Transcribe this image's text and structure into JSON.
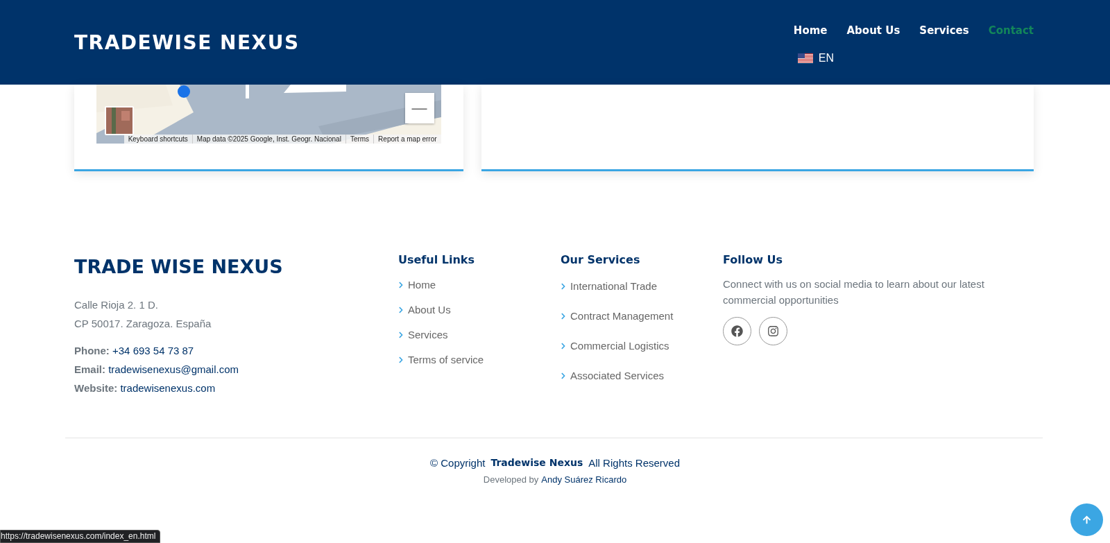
{
  "header": {
    "logo": "TRADEWISE NEXUS",
    "nav": [
      {
        "label": "Home",
        "selected": false
      },
      {
        "label": "About Us",
        "selected": false
      },
      {
        "label": "Services",
        "selected": false
      },
      {
        "label": "Contact",
        "selected": true
      }
    ],
    "language": "EN"
  },
  "map": {
    "kind": "picture",
    "zoom_out": "—",
    "attribution": [
      "Keyboard shortcuts",
      "Map data ©2025 Google, Inst. Geogr. Nacional",
      "Terms",
      "Report a map error"
    ]
  },
  "footer": {
    "brand": "TRADE WISE NEXUS",
    "address": [
      "Calle Rioja 2. 1 D.",
      "CP 50017. Zaragoza. España"
    ],
    "contacts": [
      {
        "label": "Phone:",
        "value": "+34 693 54 73 87"
      },
      {
        "label": "Email:",
        "value": "tradewisenexus@gmail.com"
      },
      {
        "label": "Website:",
        "value": "tradewisenexus.com"
      }
    ],
    "useful_links": {
      "title": "Useful Links",
      "items": [
        "Home",
        "About Us",
        "Services",
        "Terms of service"
      ]
    },
    "our_services": {
      "title": "Our Services",
      "items": [
        "International Trade",
        "Contract Management",
        "Commercial Logistics",
        "Associated Services"
      ]
    },
    "follow_us": {
      "title": "Follow Us",
      "text": "Connect with us on social media to learn about our latest commercial opportunities",
      "socials": [
        {
          "kind": "facebook"
        },
        {
          "kind": "instagram"
        }
      ]
    },
    "copyright": {
      "prefix": "© Copyright",
      "brand": "Tradewise Nexus",
      "suffix": "All Rights Reserved"
    },
    "developed": {
      "prefix": "Developed by",
      "name": "Andy Suárez Ricardo"
    }
  },
  "status_url": "https://tradewisenexus.com/index_en.html"
}
